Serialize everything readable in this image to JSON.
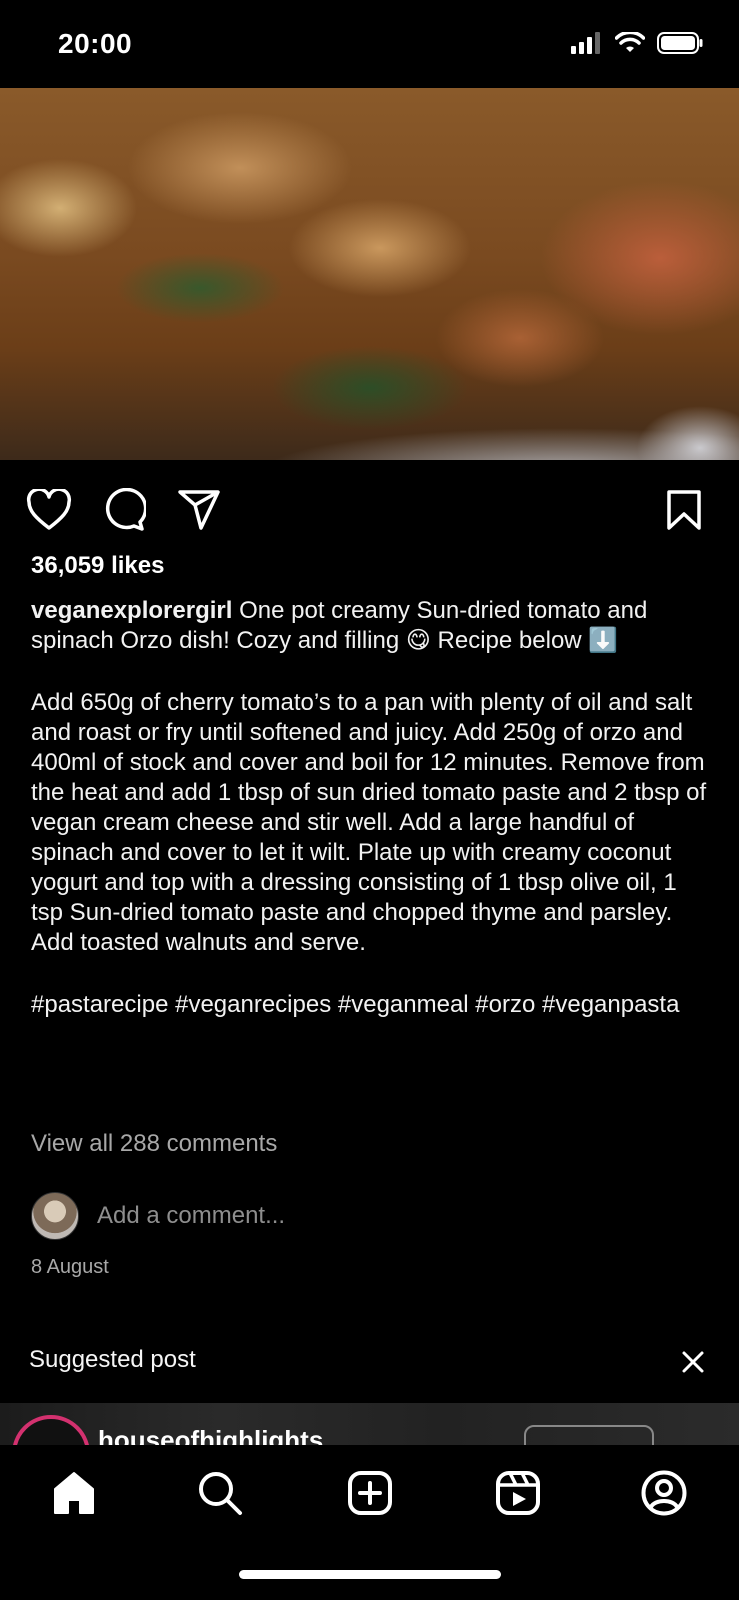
{
  "status_bar": {
    "time": "20:00",
    "icons": [
      "signal-icon",
      "wifi-icon",
      "battery-icon"
    ]
  },
  "post": {
    "image_alt": "post-photo",
    "likes": "36,059 likes",
    "username": "veganexplorergirl",
    "caption_intro": " One pot creamy Sun-dried tomato and spinach Orzo dish! Cozy and filling 😋 Recipe below ⬇️",
    "caption_body": "Add 650g of cherry tomato’s to a pan with plenty of oil and salt and roast or fry until softened and juicy. Add 250g of orzo and 400ml of stock and cover and boil for 12 minutes. Remove from the heat and add 1 tbsp of sun dried tomato paste and 2 tbsp of vegan cream cheese and stir well. Add a large handful of spinach and cover to let it wilt. Plate up with creamy coconut yogurt and top with a dressing consisting of 1 tbsp olive oil, 1 tsp Sun-dried tomato paste and chopped thyme and parsley. Add toasted walnuts and serve.",
    "hashtags": "#pastarecipe #veganrecipes #veganmeal #orzo #veganpasta",
    "view_comments": "View all 288 comments",
    "add_comment_placeholder": "Add a comment...",
    "date": "8 August"
  },
  "suggested": {
    "header": "Suggested post",
    "username": "houseofhighlights"
  },
  "tab_bar": {
    "items": [
      "home-icon",
      "search-icon",
      "create-icon",
      "reels-icon",
      "profile-icon"
    ]
  },
  "colors": {
    "background": "#000000",
    "text": "#ffffff",
    "muted": "#a8a8a8",
    "story_ring": "#d3316f"
  }
}
